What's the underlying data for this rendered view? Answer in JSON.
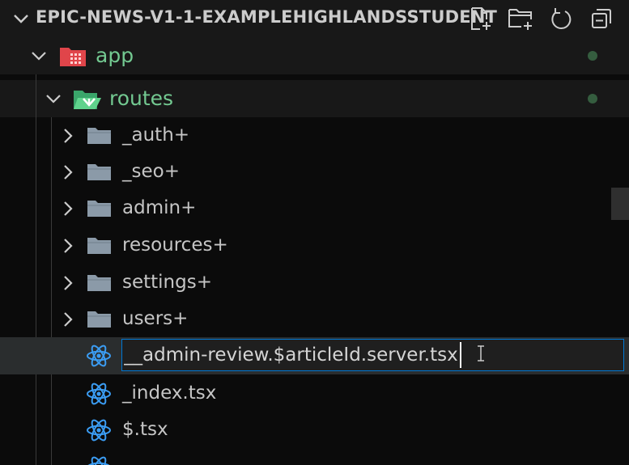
{
  "explorer": {
    "title": "EPIC-NEWS-V1-1-EXAMPLEHIGHLANDSSTUDENT",
    "actions": [
      {
        "name": "new-file-button",
        "icon": "new-file-icon"
      },
      {
        "name": "new-folder-button",
        "icon": "new-folder-icon"
      },
      {
        "name": "refresh-button",
        "icon": "refresh-icon"
      },
      {
        "name": "collapse-all-button",
        "icon": "collapse-all-icon"
      }
    ]
  },
  "tree": {
    "app": {
      "label": "app",
      "modified_color": "#73c991"
    },
    "routes": {
      "label": "routes"
    },
    "folders": [
      {
        "label": "_auth+"
      },
      {
        "label": "_seo+"
      },
      {
        "label": "admin+"
      },
      {
        "label": "resources+"
      },
      {
        "label": "settings+"
      },
      {
        "label": "users+"
      }
    ],
    "rename": {
      "value": "__admin-review.$articleId.server.tsx"
    },
    "files": [
      {
        "label": "_index.tsx"
      },
      {
        "label": "$.tsx"
      }
    ]
  },
  "colors": {
    "accent": "#0078d4",
    "react": "#3b9cf2",
    "folder": "#8b9aa8"
  }
}
